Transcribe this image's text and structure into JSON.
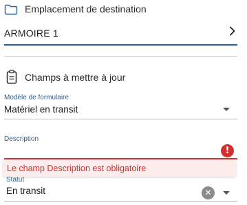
{
  "destination": {
    "section_title": "Emplacement de destination",
    "value": "ARMOIRE 1",
    "folder_icon": "folder-icon",
    "chevron_icon": "chevron-right-icon"
  },
  "fields_section": {
    "section_title": "Champs à mettre à jour",
    "icon": "clipboard-icon"
  },
  "form_model": {
    "label": "Modèle de formulaire",
    "value": "Matériel en transit",
    "dropdown_icon": "caret-down-icon"
  },
  "description": {
    "label": "Description",
    "value": "",
    "error_message": "Le champ Description est obligatoire",
    "error_icon": "exclamation-circle-icon"
  },
  "status": {
    "label": "Statut",
    "value": "En transit",
    "clear_icon": "clear-x-icon",
    "dropdown_icon": "caret-down-icon"
  },
  "colors": {
    "accent": "#2c5f8f",
    "error": "#d32f2f",
    "error_background": "#fdecec"
  }
}
